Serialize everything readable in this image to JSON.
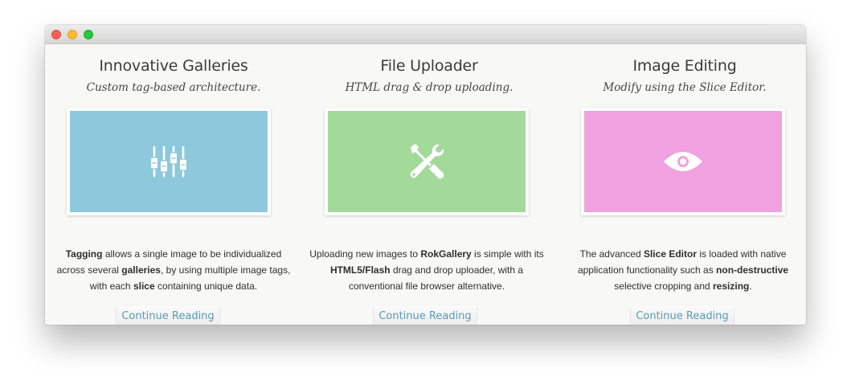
{
  "window": {
    "title": ""
  },
  "colors": {
    "blue_tile": "#8ec8dc",
    "green_tile": "#a3da9a",
    "pink_tile": "#efa2df",
    "button_text": "#5a9ab5"
  },
  "columns": [
    {
      "title": "Innovative Galleries",
      "subtitle": "Custom tag-based architecture.",
      "icon": "sliders-icon",
      "desc": [
        {
          "t": "Tagging",
          "b": true
        },
        {
          "t": " allows a single image to be individualized across several ",
          "b": false
        },
        {
          "t": "galleries",
          "b": true
        },
        {
          "t": ", by using multiple image tags, with each ",
          "b": false
        },
        {
          "t": "slice",
          "b": true
        },
        {
          "t": " containing unique data.",
          "b": false
        }
      ],
      "button": "Continue Reading"
    },
    {
      "title": "File Uploader",
      "subtitle": "HTML drag & drop uploading.",
      "icon": "wrench-screwdriver-icon",
      "desc": [
        {
          "t": "Uploading new images to ",
          "b": false
        },
        {
          "t": "RokGallery",
          "b": true
        },
        {
          "t": " is simple with its ",
          "b": false
        },
        {
          "t": "HTML5/Flash",
          "b": true
        },
        {
          "t": " drag and drop uploader, with a conventional file browser alternative.",
          "b": false
        }
      ],
      "button": "Continue Reading"
    },
    {
      "title": "Image Editing",
      "subtitle": "Modify using the Slice Editor.",
      "icon": "eye-icon",
      "desc": [
        {
          "t": "The advanced ",
          "b": false
        },
        {
          "t": "Slice Editor",
          "b": true
        },
        {
          "t": " is loaded with native application functionality such as ",
          "b": false
        },
        {
          "t": "non-destructive",
          "b": true
        },
        {
          "t": " selective cropping and ",
          "b": false
        },
        {
          "t": "resizing",
          "b": true
        },
        {
          "t": ".",
          "b": false
        }
      ],
      "button": "Continue Reading"
    }
  ]
}
